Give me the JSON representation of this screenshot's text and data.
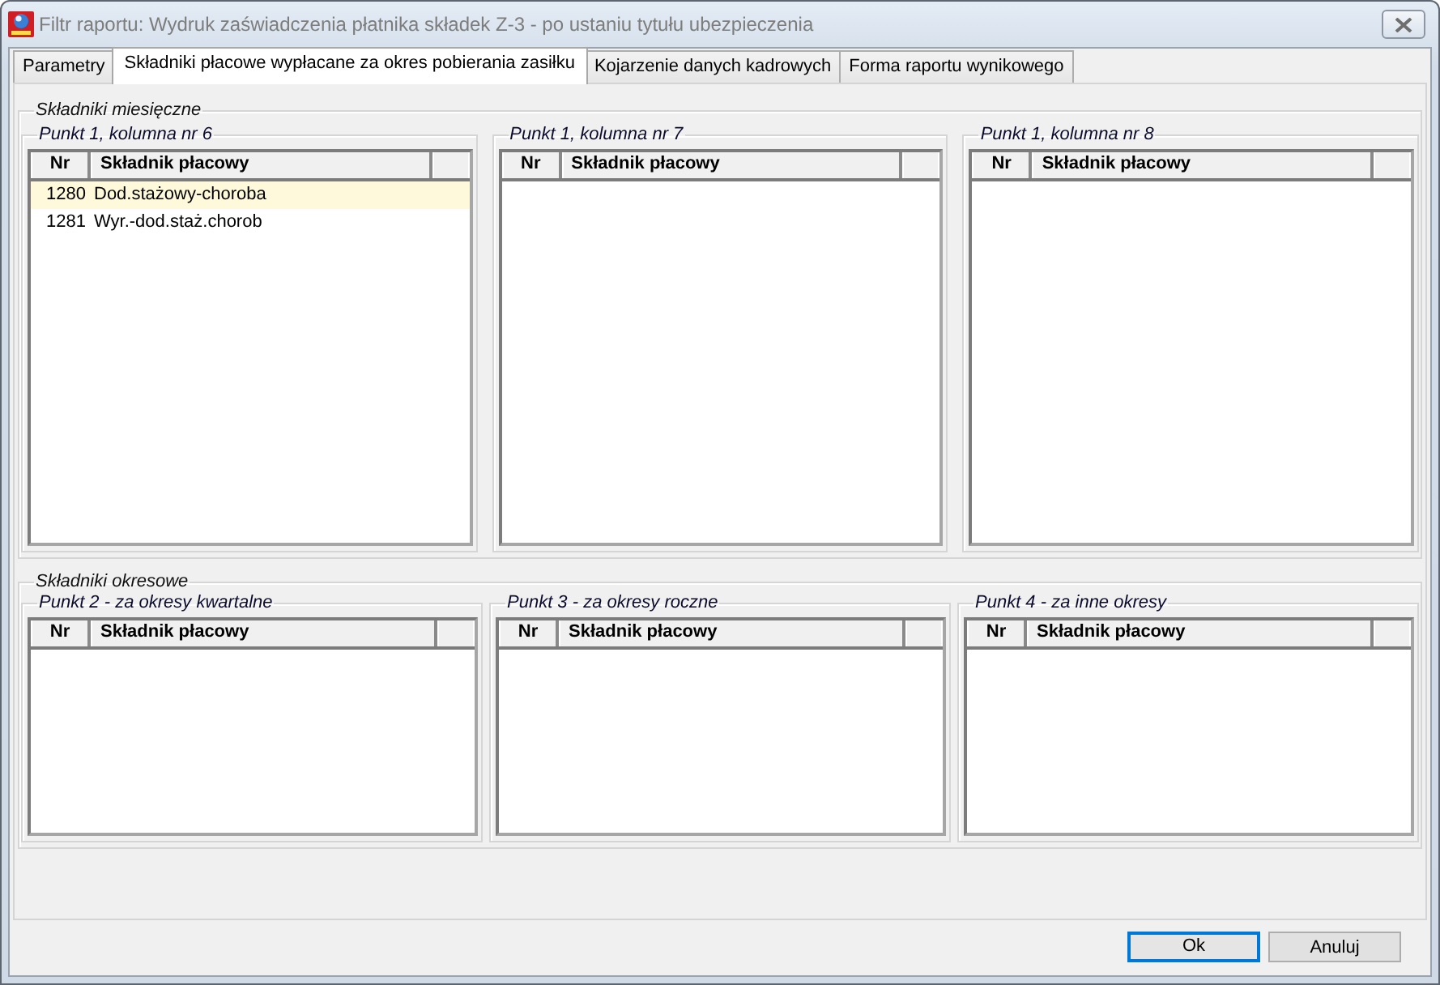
{
  "window": {
    "title": "Filtr raportu: Wydruk zaświadczenia płatnika składek Z-3 - po ustaniu tytułu ubezpieczenia"
  },
  "tabs": [
    {
      "label": "Parametry",
      "selected": false
    },
    {
      "label": "Składniki płacowe wypłacane za okres pobierania zasiłku",
      "selected": true
    },
    {
      "label": "Kojarzenie danych kadrowych",
      "selected": false
    },
    {
      "label": "Forma raportu wynikowego",
      "selected": false
    }
  ],
  "groups": [
    {
      "title": "Składniki miesięczne",
      "panels": [
        {
          "title": "Punkt 1, kolumna nr 6",
          "columns": [
            "Nr",
            "Składnik płacowy"
          ],
          "rows": [
            {
              "nr": "1280",
              "name": "Dod.stażowy-choroba",
              "selected": true
            },
            {
              "nr": "1281",
              "name": "Wyr.-dod.staż.chorob",
              "selected": false
            }
          ]
        },
        {
          "title": "Punkt 1, kolumna nr 7",
          "columns": [
            "Nr",
            "Składnik płacowy"
          ]
        },
        {
          "title": "Punkt 1, kolumna nr 8",
          "columns": [
            "Nr",
            "Składnik płacowy"
          ]
        }
      ]
    },
    {
      "title": "Składniki okresowe",
      "panels": [
        {
          "title": "Punkt 2 - za okresy kwartalne",
          "columns": [
            "Nr",
            "Składnik płacowy"
          ]
        },
        {
          "title": "Punkt 3 - za okresy roczne",
          "columns": [
            "Nr",
            "Składnik płacowy"
          ]
        },
        {
          "title": "Punkt 4 - za inne okresy",
          "columns": [
            "Nr",
            "Składnik płacowy"
          ]
        }
      ]
    }
  ],
  "buttons": [
    {
      "label": "Ok",
      "focused": true
    },
    {
      "label": "Anuluj",
      "focused": false
    }
  ]
}
